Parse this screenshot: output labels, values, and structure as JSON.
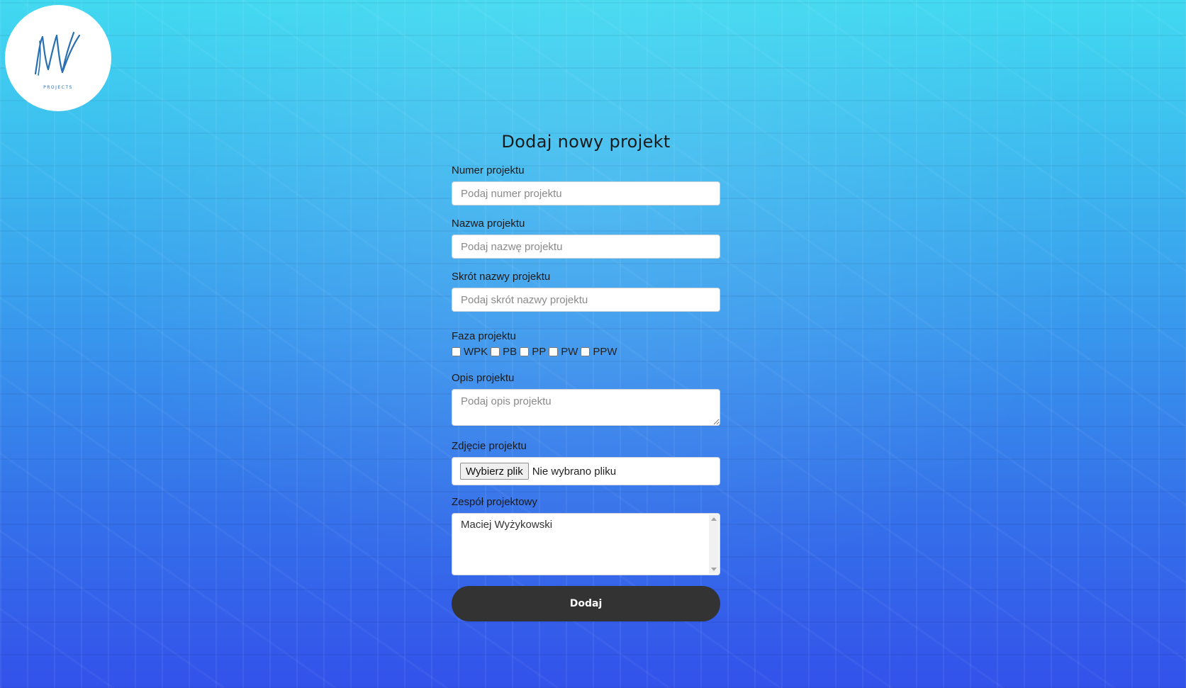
{
  "logo": {
    "subtitle": "PROJECTS",
    "icon": "mw-signature-logo",
    "brand_color": "#2a6fb0"
  },
  "form": {
    "title": "Dodaj nowy projekt",
    "number": {
      "label": "Numer projektu",
      "placeholder": "Podaj numer projektu"
    },
    "name": {
      "label": "Nazwa projektu",
      "placeholder": "Podaj nazwę projektu"
    },
    "short": {
      "label": "Skrót nazwy projektu",
      "placeholder": "Podaj skrót nazwy projektu"
    },
    "phase": {
      "label": "Faza projektu",
      "options": [
        "WPK",
        "PB",
        "PP",
        "PW",
        "PPW"
      ]
    },
    "description": {
      "label": "Opis projektu",
      "placeholder": "Podaj opis projektu"
    },
    "image": {
      "label": "Zdjęcie projektu",
      "button": "Wybierz plik",
      "status": "Nie wybrano pliku"
    },
    "team": {
      "label": "Zespół projektowy",
      "members": [
        "Maciej Wyżykowski"
      ]
    },
    "submit": "Dodaj"
  },
  "colors": {
    "background_top": "#41d9f0",
    "background_bottom": "#3352ea",
    "button": "#333333"
  }
}
